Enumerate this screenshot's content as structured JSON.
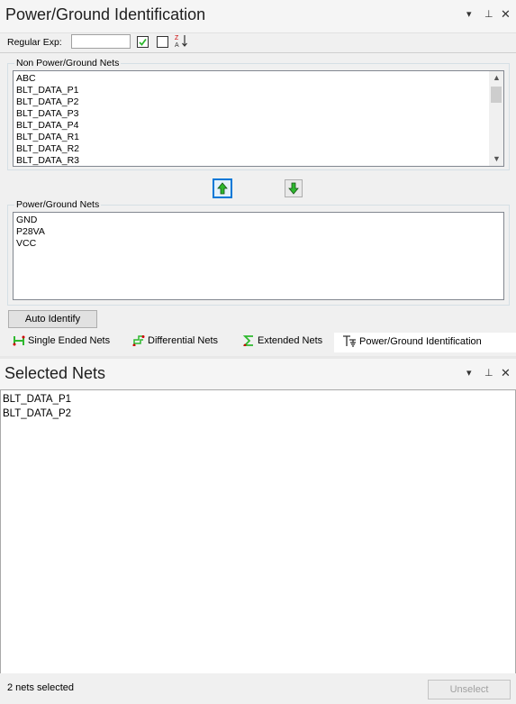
{
  "top_pane": {
    "title": "Power/Ground Identification",
    "regex_label": "Regular Exp:",
    "regex_value": ""
  },
  "non_pg": {
    "label": "Non Power/Ground Nets",
    "items": [
      "ABC",
      "BLT_DATA_P1",
      "BLT_DATA_P2",
      "BLT_DATA_P3",
      "BLT_DATA_P4",
      "BLT_DATA_R1",
      "BLT_DATA_R2",
      "BLT_DATA_R3"
    ]
  },
  "pg": {
    "label": "Power/Ground Nets",
    "items": [
      "GND",
      "P28VA",
      "VCC"
    ]
  },
  "auto_identify_label": "Auto Identify",
  "tabs": [
    {
      "label": "Single Ended Nets",
      "icon": "single-ended-icon"
    },
    {
      "label": "Differential Nets",
      "icon": "differential-icon"
    },
    {
      "label": "Extended Nets",
      "icon": "extended-icon"
    },
    {
      "label": "Power/Ground Identification",
      "icon": "power-ground-icon"
    }
  ],
  "selected_pane": {
    "title": "Selected Nets",
    "items": [
      "BLT_DATA_P1",
      "BLT_DATA_P2"
    ],
    "status": "2 nets selected",
    "unselect_label": "Unselect"
  },
  "colors": {
    "panel_bg": "#f0f0f0",
    "accent": "#0078d7",
    "arrow_green": "#2eb82e"
  }
}
